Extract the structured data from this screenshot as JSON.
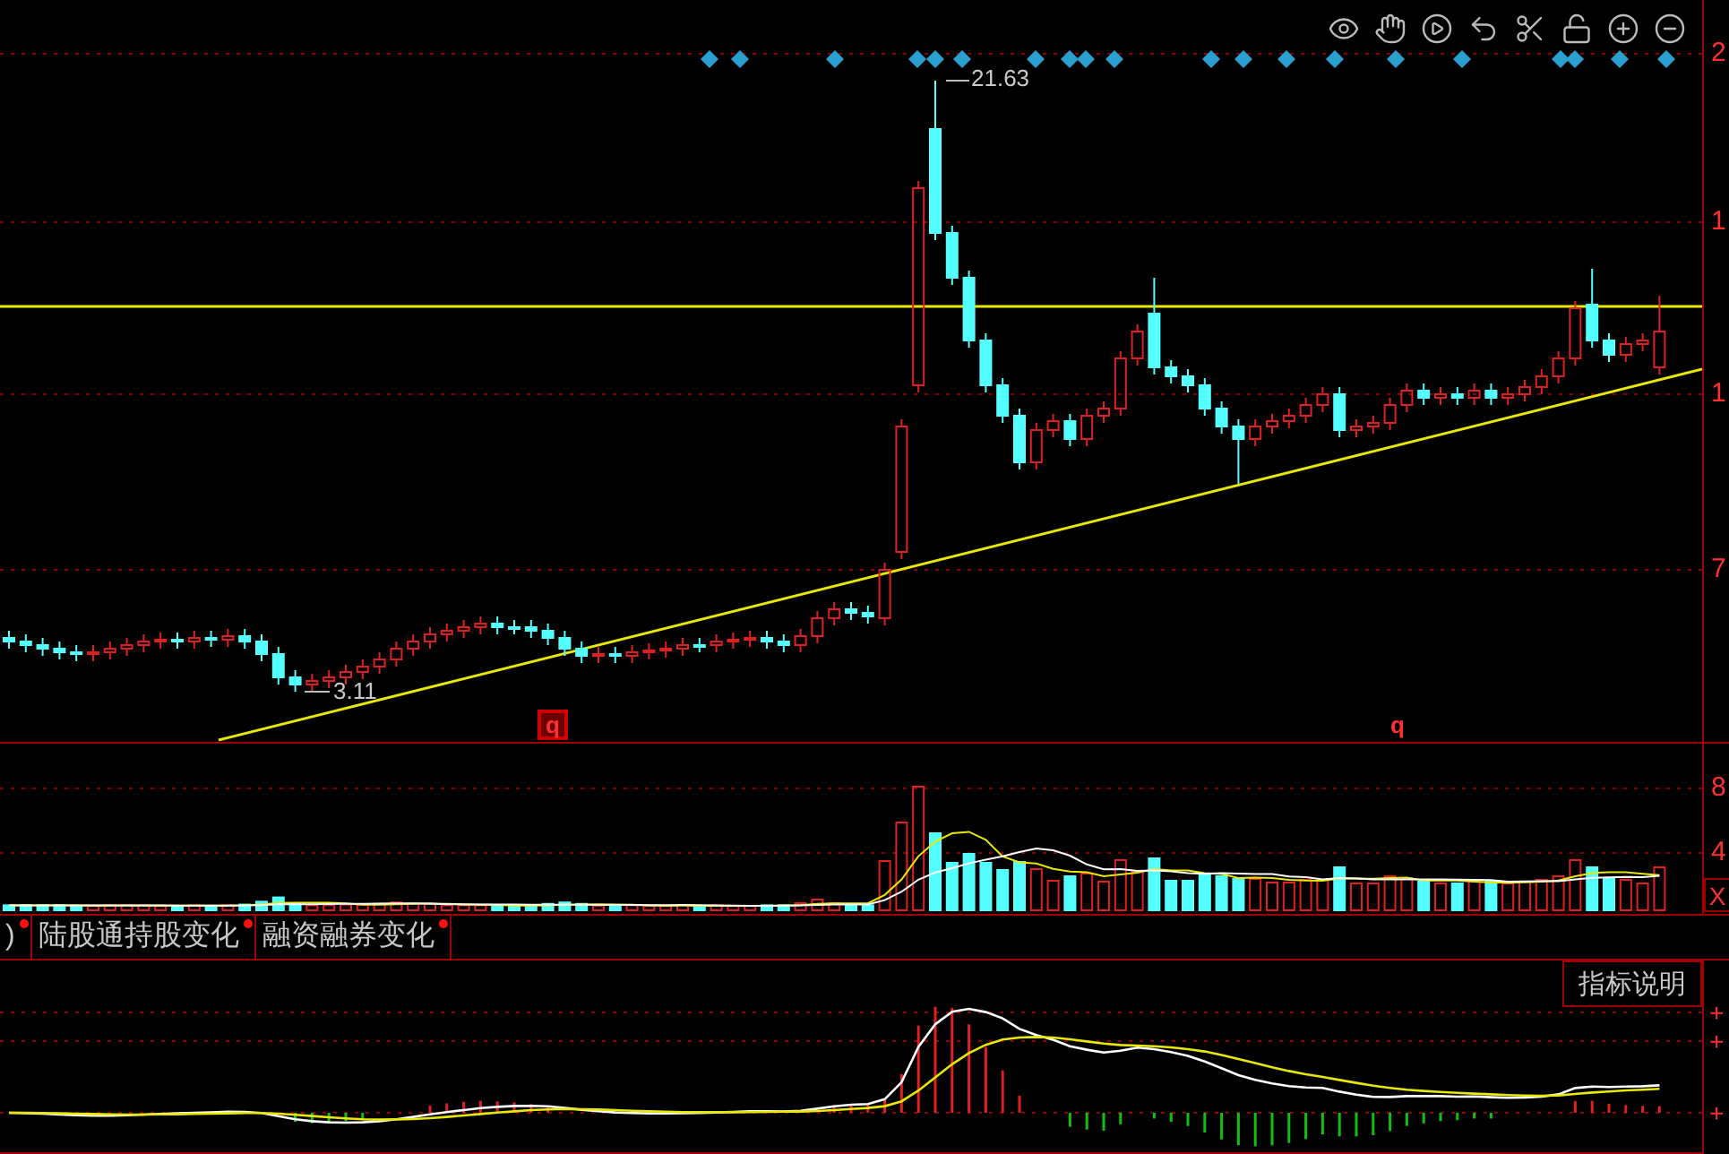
{
  "price_axis": {
    "labels": [
      "2",
      "1",
      "1",
      "7"
    ]
  },
  "price_labels": {
    "high": "21.63",
    "low": "3.11"
  },
  "markers": [
    "q",
    "q"
  ],
  "volume_axis": {
    "labels": [
      "8",
      "4"
    ],
    "close_button": "X"
  },
  "tabs": [
    {
      "label": ")"
    },
    {
      "label": "陆股通持股变化"
    },
    {
      "label": "融资融券变化"
    }
  ],
  "indicator_button": "指标说明",
  "macd_axis": {
    "labels": [
      "+",
      "+",
      "+"
    ]
  }
}
